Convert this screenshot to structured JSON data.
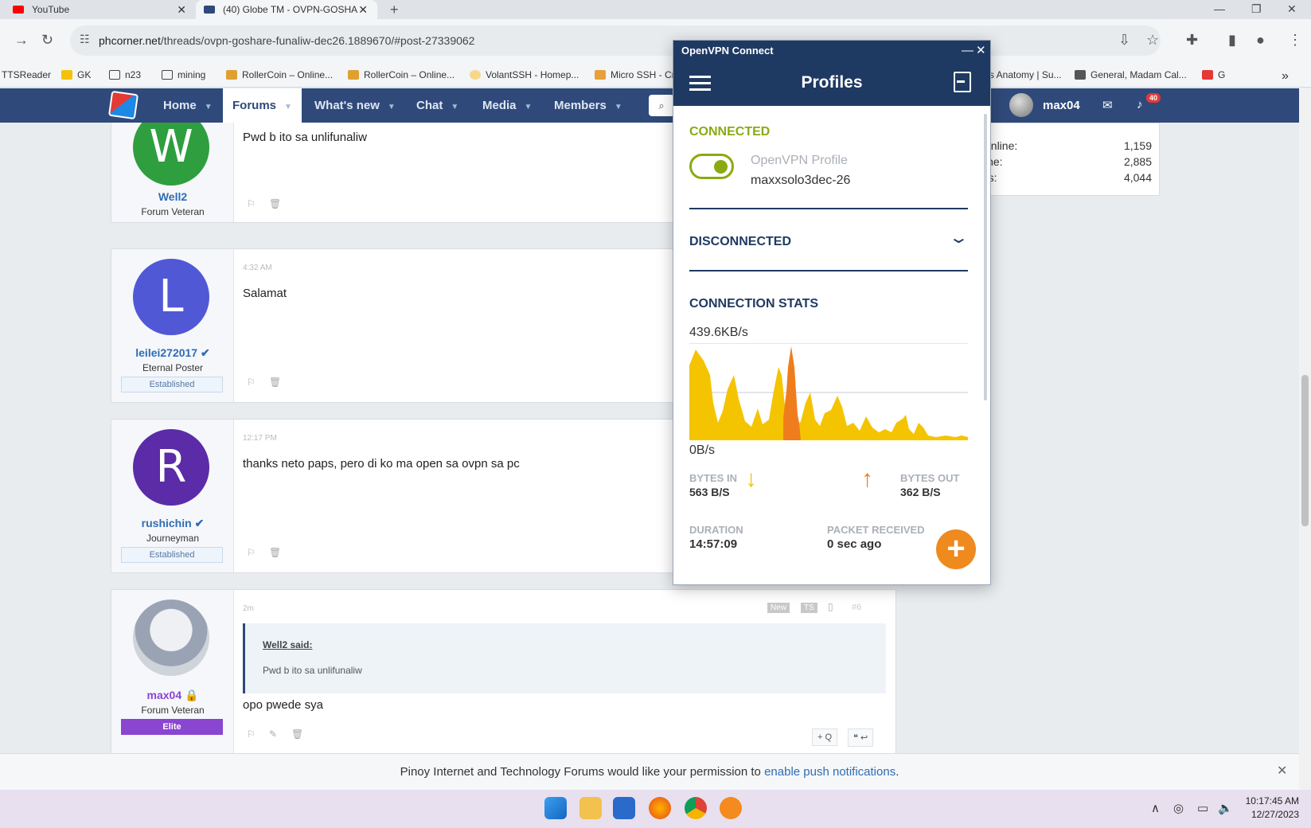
{
  "browser": {
    "tabs": [
      {
        "title": "YouTube",
        "color": "#ff0000"
      },
      {
        "title": "(40) Globe TM - OVPN-GOSHA",
        "color": "#2f4a7a"
      }
    ],
    "url_host": "phcorner.net",
    "url_path": "/threads/ovpn-goshare-funaliw-dec26.1889670/#post-27339062",
    "bookmarks": [
      "TTSReader",
      "GK",
      "n23",
      "mining",
      "RollerCoin – Online...",
      "RollerCoin – Online...",
      "VolantSSH - Homep...",
      "Micro SSH - Cr",
      "s Anatomy | Su...",
      "General, Madam Cal...",
      "G"
    ]
  },
  "site": {
    "nav": [
      {
        "label": "Home"
      },
      {
        "label": "Forums"
      },
      {
        "label": "What's new"
      },
      {
        "label": "Chat"
      },
      {
        "label": "Media"
      },
      {
        "label": "Members"
      }
    ],
    "username": "max04",
    "alert_count": "40"
  },
  "stats": [
    {
      "label": "online:",
      "value": "1,159"
    },
    {
      "label": "ine:",
      "value": "2,885"
    },
    {
      "label": "rs:",
      "value": "4,044"
    }
  ],
  "posts": [
    {
      "avatar_letter": "W",
      "avatar_color": "#2e9e3e",
      "name": "Well2",
      "title": "Forum Veteran",
      "badge": "",
      "time": "",
      "text": "Pwd b ito sa unlifunaliw"
    },
    {
      "avatar_letter": "L",
      "avatar_color": "#5158d6",
      "name": "leilei272017",
      "title": "Eternal Poster",
      "badge": "Established",
      "time": "4:32 AM",
      "text": "Salamat"
    },
    {
      "avatar_letter": "R",
      "avatar_color": "#5b2ba8",
      "name": "rushichin",
      "title": "Journeyman",
      "badge": "Established",
      "time": "12:17 PM",
      "text": "thanks neto paps, pero di ko ma open sa ovpn sa pc"
    },
    {
      "avatar_letter": "",
      "avatar_color": "#c9cdd6",
      "name": "max04",
      "title": "Forum Veteran",
      "badge": "Elite",
      "time": "2m",
      "text": "opo pwede sya",
      "quote_by": "Well2 said:",
      "quote_text": "Pwd b ito sa unlifunaliw",
      "tags": [
        "New",
        "TS",
        "#6"
      ]
    }
  ],
  "notification": {
    "text": "Pinoy Internet and Technology Forums would like your permission to ",
    "link": "enable push notifications",
    "end": "."
  },
  "vpn": {
    "window_title": "OpenVPN Connect",
    "header_title": "Profiles",
    "connected_label": "CONNECTED",
    "profile_type": "OpenVPN Profile",
    "profile_name": "maxxsolo3dec-26",
    "toggle_on": true,
    "disconnected_label": "DISCONNECTED",
    "stats_label": "CONNECTION STATS",
    "speed_max": "439.6KB/s",
    "speed_min": "0B/s",
    "bytes_in_label": "BYTES IN",
    "bytes_in_value": "563 B/S",
    "bytes_out_label": "BYTES OUT",
    "bytes_out_value": "362 B/S",
    "duration_label": "DURATION",
    "duration_value": "14:57:09",
    "packet_label": "PACKET RECEIVED",
    "packet_value": "0 sec ago",
    "colors": {
      "in": "#f5c400",
      "out": "#ef7d1e",
      "accent": "#8aaa12",
      "header": "#1f3a62"
    }
  },
  "taskbar": {
    "time": "10:17:45 AM",
    "date": "12/27/2023"
  }
}
